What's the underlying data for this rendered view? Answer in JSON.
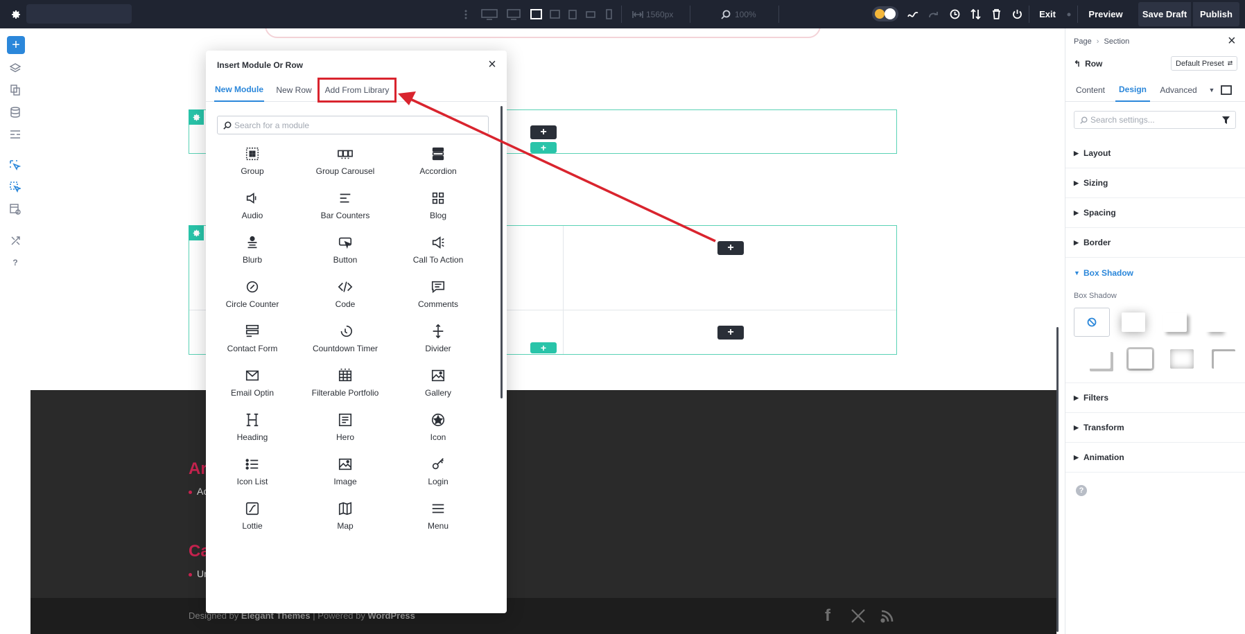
{
  "toolbar": {
    "width_label": "1560px",
    "zoom_label": "100%",
    "exit_label": "Exit",
    "preview_label": "Preview",
    "save_draft_label": "Save Draft",
    "publish_label": "Publish"
  },
  "modal": {
    "title": "Insert Module Or Row",
    "tabs": [
      "New Module",
      "New Row",
      "Add From Library"
    ],
    "search_placeholder": "Search for a module",
    "modules": [
      {
        "label": "Group",
        "icon": "group-icon"
      },
      {
        "label": "Group Carousel",
        "icon": "group-carousel-icon"
      },
      {
        "label": "Accordion",
        "icon": "accordion-icon"
      },
      {
        "label": "Audio",
        "icon": "audio-icon"
      },
      {
        "label": "Bar Counters",
        "icon": "bar-counters-icon"
      },
      {
        "label": "Blog",
        "icon": "blog-icon"
      },
      {
        "label": "Blurb",
        "icon": "blurb-icon"
      },
      {
        "label": "Button",
        "icon": "button-icon"
      },
      {
        "label": "Call To Action",
        "icon": "call-to-action-icon"
      },
      {
        "label": "Circle Counter",
        "icon": "circle-counter-icon"
      },
      {
        "label": "Code",
        "icon": "code-icon"
      },
      {
        "label": "Comments",
        "icon": "comments-icon"
      },
      {
        "label": "Contact Form",
        "icon": "contact-form-icon"
      },
      {
        "label": "Countdown Timer",
        "icon": "countdown-timer-icon"
      },
      {
        "label": "Divider",
        "icon": "divider-icon"
      },
      {
        "label": "Email Optin",
        "icon": "email-optin-icon"
      },
      {
        "label": "Filterable Portfolio",
        "icon": "filterable-portfolio-icon"
      },
      {
        "label": "Gallery",
        "icon": "gallery-icon"
      },
      {
        "label": "Heading",
        "icon": "heading-icon"
      },
      {
        "label": "Hero",
        "icon": "hero-icon"
      },
      {
        "label": "Icon",
        "icon": "icon-module-icon"
      },
      {
        "label": "Icon List",
        "icon": "icon-list-icon"
      },
      {
        "label": "Image",
        "icon": "image-icon"
      },
      {
        "label": "Login",
        "icon": "login-icon"
      },
      {
        "label": "Lottie",
        "icon": "lottie-icon"
      },
      {
        "label": "Map",
        "icon": "map-icon"
      },
      {
        "label": "Menu",
        "icon": "menu-icon"
      }
    ]
  },
  "panel": {
    "breadcrumb": [
      "Page",
      "Section"
    ],
    "element": "Row",
    "preset": "Default Preset",
    "tabs": [
      "Content",
      "Design",
      "Advanced"
    ],
    "search_placeholder": "Search settings...",
    "sections": [
      "Layout",
      "Sizing",
      "Spacing",
      "Border",
      "Box Shadow",
      "Filters",
      "Transform",
      "Animation"
    ],
    "box_shadow_label": "Box Shadow"
  },
  "footer": {
    "heading_1": "Ar",
    "bullet_1": "Ac",
    "heading_2": "Ca",
    "bullet_2": "Ur",
    "credit_prefix": "Designed by",
    "credit_brand": "Elegant Themes",
    "credit_mid": "| Powered by",
    "credit_platform": "WordPress"
  },
  "colors": {
    "topbar": "#1f2431",
    "accent_blue": "#2b87da",
    "row_teal": "#29c4a9",
    "highlight_red": "#d9242e",
    "footer_dark": "#2a2a2a",
    "footer_accent": "#c8234f"
  }
}
